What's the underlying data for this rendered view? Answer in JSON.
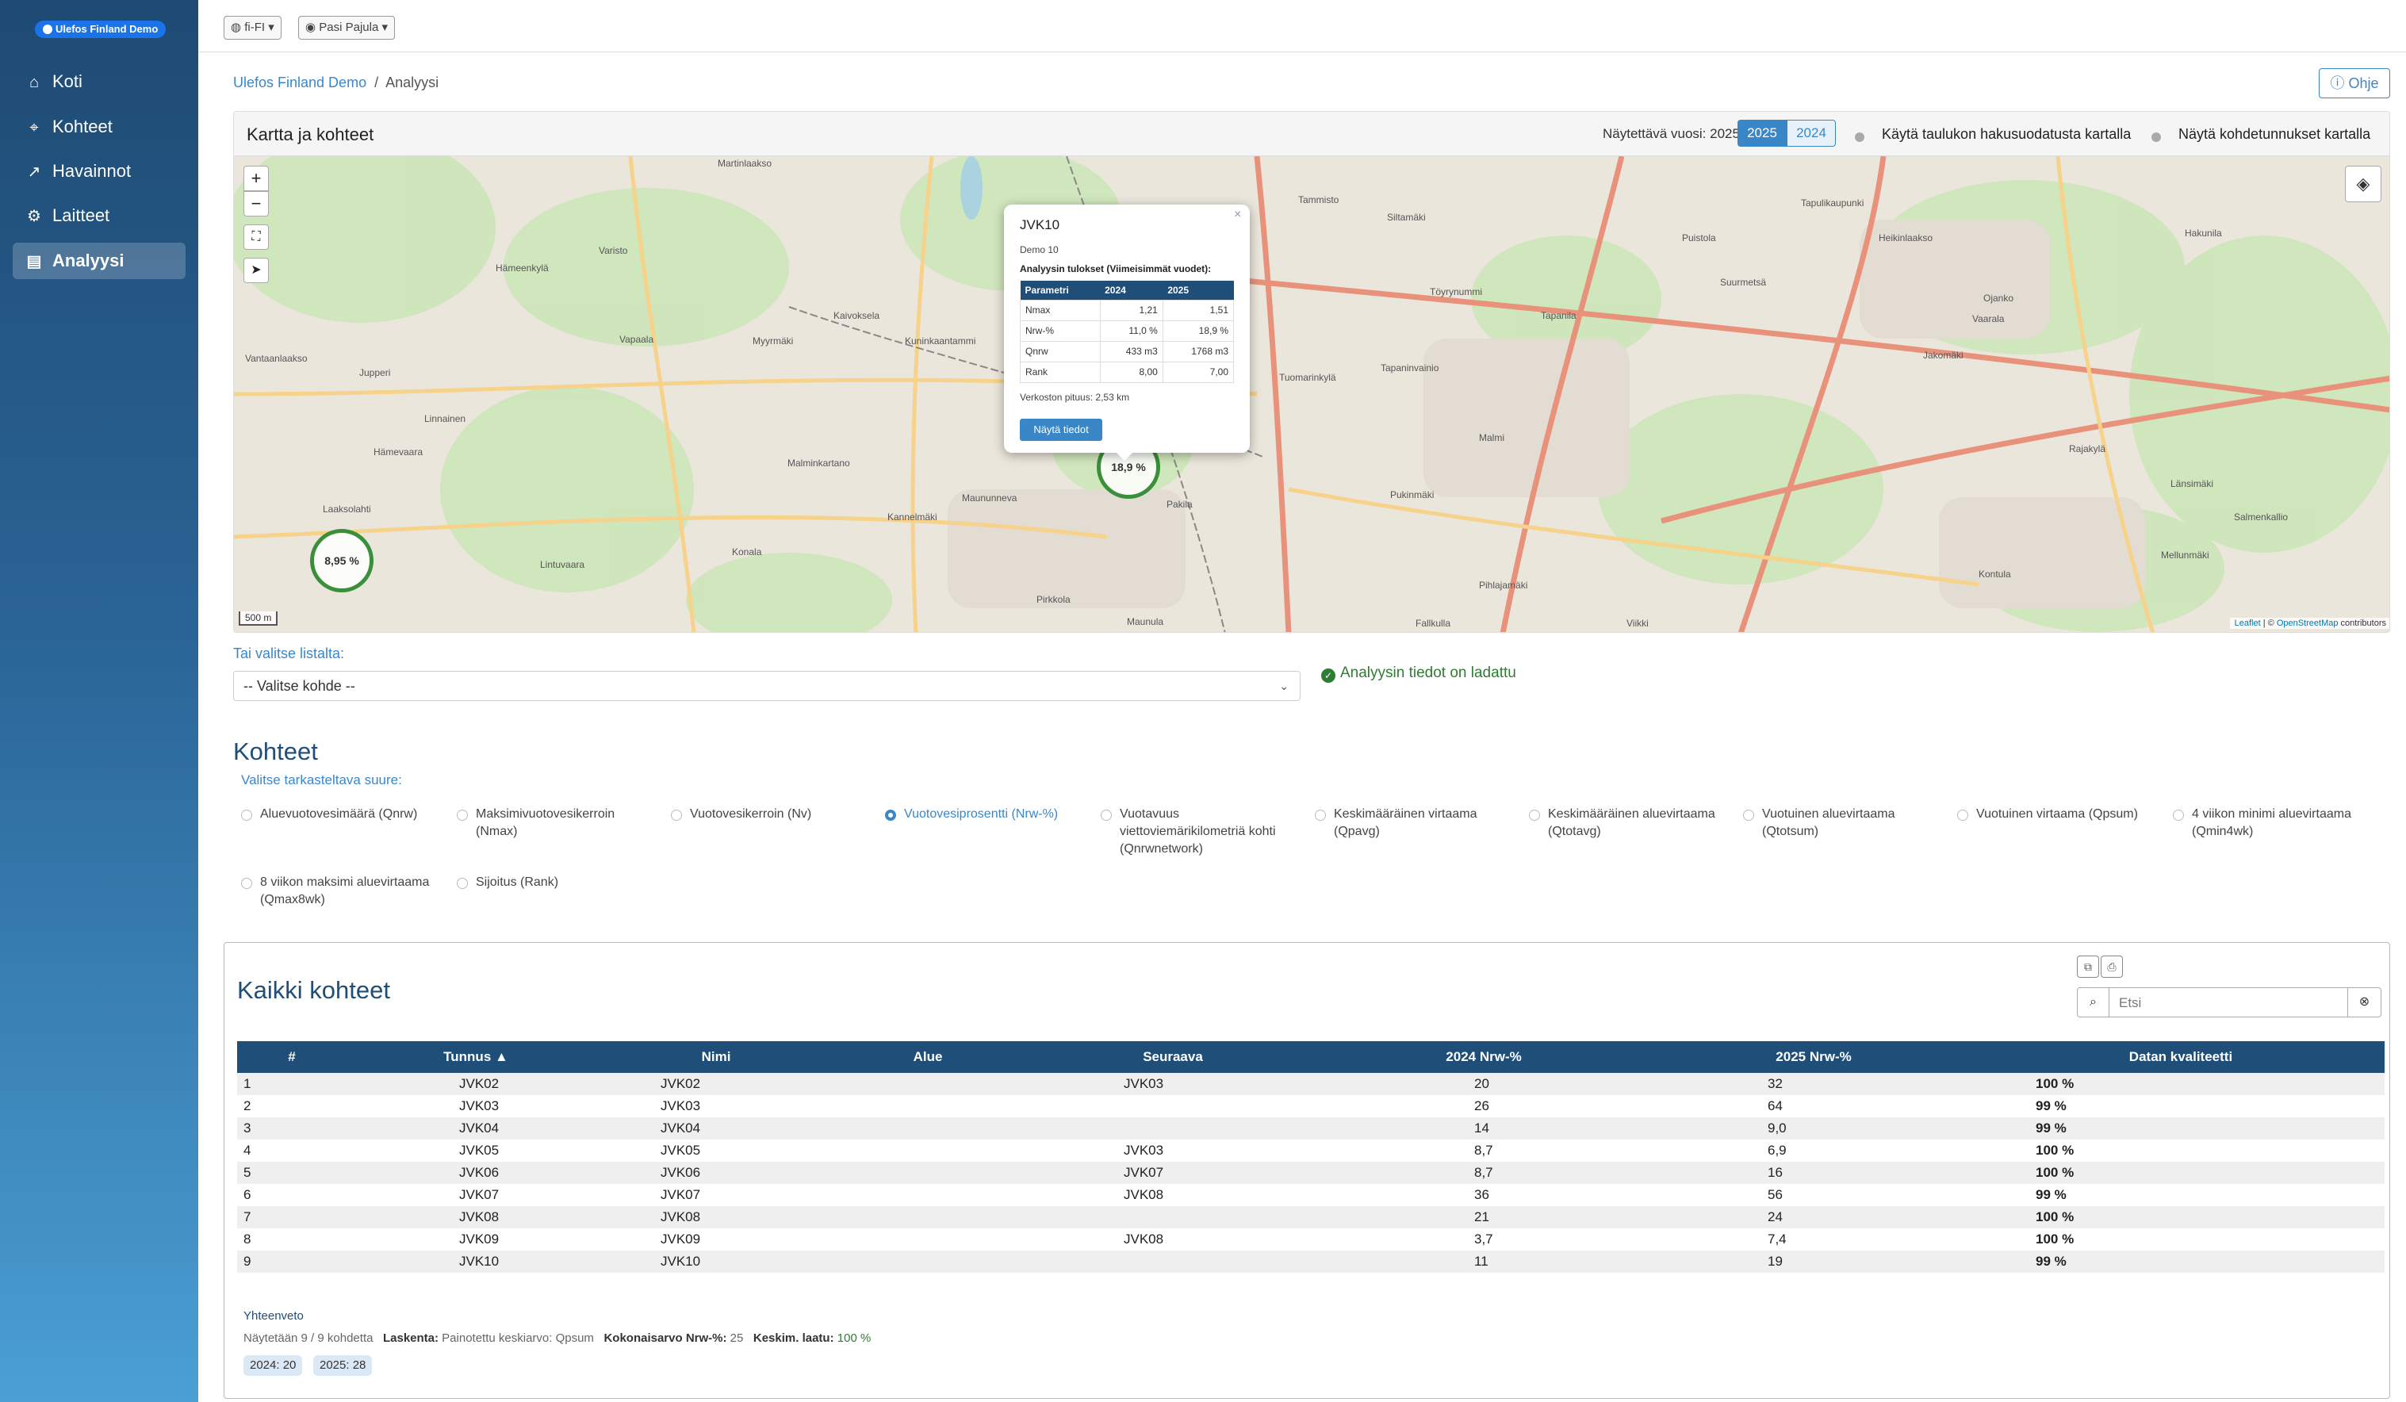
{
  "brand": "Ulefos Finland Demo",
  "nav": [
    {
      "label": "Koti",
      "icon": "home-icon"
    },
    {
      "label": "Kohteet",
      "icon": "map-pin-icon"
    },
    {
      "label": "Havainnot",
      "icon": "line-chart-icon"
    },
    {
      "label": "Laitteet",
      "icon": "gear-icon"
    },
    {
      "label": "Analyysi",
      "icon": "report-icon",
      "active": true
    }
  ],
  "topbar": {
    "locale": "fi-FI",
    "user": "Pasi Pajula"
  },
  "breadcrumb": {
    "root": "Ulefos Finland Demo",
    "current": "Analyysi"
  },
  "help_label": "Ohje",
  "map_card": {
    "title": "Kartta ja kohteet",
    "year_label": "Näytettävä vuosi: 2025",
    "years": [
      "2025",
      "2024"
    ],
    "toggle1": "Käytä taulukon hakusuodatusta kartalla",
    "toggle2": "Näytä kohdetunnukset kartalla",
    "scale": "500 m",
    "attribution_link1": "Leaflet",
    "attribution_link2": "OpenStreetMap",
    "attribution_rest": " contributors",
    "bubbles": [
      "18,9 %",
      "8,95 %"
    ],
    "places": [
      "Martinlaakso",
      "Varisto",
      "Hämeenkylä",
      "Vapaala",
      "Myyrmäki",
      "Kaivoksela",
      "Kuninkaantammi",
      "Vantaanlaakso",
      "Jupperi",
      "Linnainen",
      "Hämevaara",
      "Laaksolahti",
      "Lintuvaara",
      "Konala",
      "Kannelmäki",
      "Malminkartano",
      "Maununneva",
      "Pakila",
      "Tammisto",
      "Siltamäki",
      "Tapulikaupunki",
      "Puistola",
      "Heikinlaakso",
      "Suurmetsä",
      "Tapaninvainio",
      "Tapanila",
      "Pukinmäki",
      "Malmi",
      "Jakomäki",
      "Vaarala",
      "Ojanko",
      "Rajakylä",
      "Länsimäki",
      "Salmenkallio",
      "Kontula",
      "Mellunmäki",
      "Tuomarinkylä",
      "Töyrynummi",
      "Hakunila",
      "Pihlajamäki",
      "Maunula",
      "Pirkkola",
      "Fallkulla",
      "Viikki"
    ],
    "popup": {
      "title": "JVK10",
      "subtitle": "Demo 10",
      "heading": "Analyysin tulokset (Viimeisimmät vuodet):",
      "columns": [
        "Parametri",
        "2024",
        "2025"
      ],
      "rows": [
        [
          "Nmax",
          "1,21",
          "1,51"
        ],
        [
          "Nrw-%",
          "11,0 %",
          "18,9 %"
        ],
        [
          "Qnrw",
          "433 m3",
          "1768 m3"
        ],
        [
          "Rank",
          "8,00",
          "7,00"
        ]
      ],
      "length": "Verkoston pituus: 2,53 km",
      "button": "Näytä tiedot",
      "close": "×"
    }
  },
  "select_label": "Tai valitse listalta:",
  "select_value": "-- Valitse kohde --",
  "loaded_msg": "Analyysin tiedot on ladattu",
  "section_title": "Kohteet",
  "quantity_label": "Valitse tarkasteltava suure:",
  "options": [
    "Aluevuotovesimäärä (Qnrw)",
    "Maksimivuotovesikerroin (Nmax)",
    "Vuotovesikerroin (Nv)",
    "Vuotovesiprosentti (Nrw-%)",
    "Vuotavuus viettoviemärikilometriä kohti (Qnrwnetwork)",
    "Keskimääräinen virtaama (Qpavg)",
    "Keskimääräinen aluevirtaama (Qtotavg)",
    "Vuotuinen aluevirtaama (Qtotsum)",
    "Vuotuinen virtaama (Qpsum)",
    "4 viikon minimi aluevirtaama (Qmin4wk)",
    "8 viikon maksimi aluevirtaama (Qmax8wk)",
    "Sijoitus (Rank)"
  ],
  "selected_option": "Vuotovesiprosentti (Nrw-%)",
  "table": {
    "title": "Kaikki kohteet",
    "search_placeholder": "Etsi",
    "columns": [
      "#",
      "Tunnus ▲",
      "Nimi",
      "Alue",
      "Seuraava",
      "2024 Nrw-%",
      "2025 Nrw-%",
      "Datan kvaliteetti"
    ],
    "rows": [
      [
        "1",
        "JVK02",
        "JVK02",
        "",
        "JVK03",
        "20",
        "32",
        "100 %"
      ],
      [
        "2",
        "JVK03",
        "JVK03",
        "",
        "",
        "26",
        "64",
        "99 %"
      ],
      [
        "3",
        "JVK04",
        "JVK04",
        "",
        "",
        "14",
        "9,0",
        "99 %"
      ],
      [
        "4",
        "JVK05",
        "JVK05",
        "",
        "JVK03",
        "8,7",
        "6,9",
        "100 %"
      ],
      [
        "5",
        "JVK06",
        "JVK06",
        "",
        "JVK07",
        "8,7",
        "16",
        "100 %"
      ],
      [
        "6",
        "JVK07",
        "JVK07",
        "",
        "JVK08",
        "36",
        "56",
        "99 %"
      ],
      [
        "7",
        "JVK08",
        "JVK08",
        "",
        "",
        "21",
        "24",
        "100 %"
      ],
      [
        "8",
        "JVK09",
        "JVK09",
        "",
        "JVK08",
        "3,7",
        "7,4",
        "100 %"
      ],
      [
        "9",
        "JVK10",
        "JVK10",
        "",
        "",
        "11",
        "19",
        "99 %"
      ]
    ]
  },
  "summary": {
    "title": "Yhteenveto",
    "shown": "Näytetään 9 / 9 kohdetta",
    "calc_label": "Laskenta:",
    "calc_value": "Painotettu keskiarvo: Qpsum",
    "total_label": "Kokonaisarvo Nrw-%:",
    "total_value": "25",
    "quality_label": "Keskim. laatu:",
    "quality_value": "100 %",
    "pills": [
      "2024: 20",
      "2025: 28"
    ]
  },
  "colors": {
    "primary": "#3a87c8",
    "header": "#1f4e79",
    "good": "#2e7d32"
  }
}
